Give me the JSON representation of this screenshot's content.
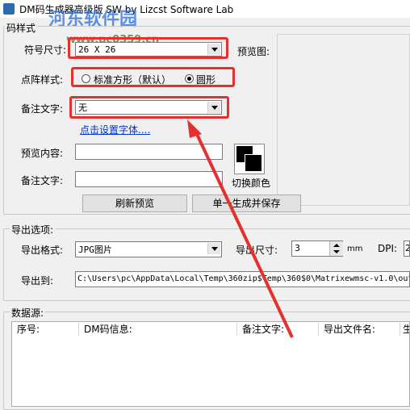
{
  "window": {
    "title": "DM码生成器高级版 SW  by Lizcst Software Lab"
  },
  "watermark": {
    "text": "河东软件园",
    "url": "www.pc0359.cn"
  },
  "style_group": {
    "legend": "码样式",
    "symbol_size_label": "符号尺寸:",
    "symbol_size_value": "26 X 26",
    "preview_image_label": "预览图:",
    "dot_style_label": "点阵样式:",
    "dot_style_option_square": "标准方形（默认）",
    "dot_style_option_circle": "圆形",
    "note_text_label": "备注文字:",
    "note_text_value": "无",
    "set_font_link": "点击设置字体....",
    "preview_content_label": "预览内容:",
    "note_text2_label": "备注文字:",
    "switch_color_label": "切换颜色",
    "refresh_button": "刷新预览",
    "generate_button": "单一生成并保存"
  },
  "export_group": {
    "legend": "导出选项:",
    "format_label": "导出格式:",
    "format_value": "JPG图片",
    "size_label": "导出尺寸:",
    "size_value": "3",
    "size_unit": "mm",
    "dpi_label": "DPI:",
    "dpi_value": "2",
    "export_to_label": "导出到:",
    "export_to_value": "C:\\Users\\pc\\AppData\\Local\\Temp\\360zip$Temp\\360$0\\Matrixewmsc-v1.0\\out"
  },
  "data_group": {
    "legend": "数据源:",
    "columns": [
      "序号:",
      "DM码信息:",
      "备注文字:",
      "导出文件名:",
      "生"
    ]
  },
  "colors": {
    "highlight": "#e53030",
    "arrow": "#e53030",
    "link": "#0033cc"
  }
}
